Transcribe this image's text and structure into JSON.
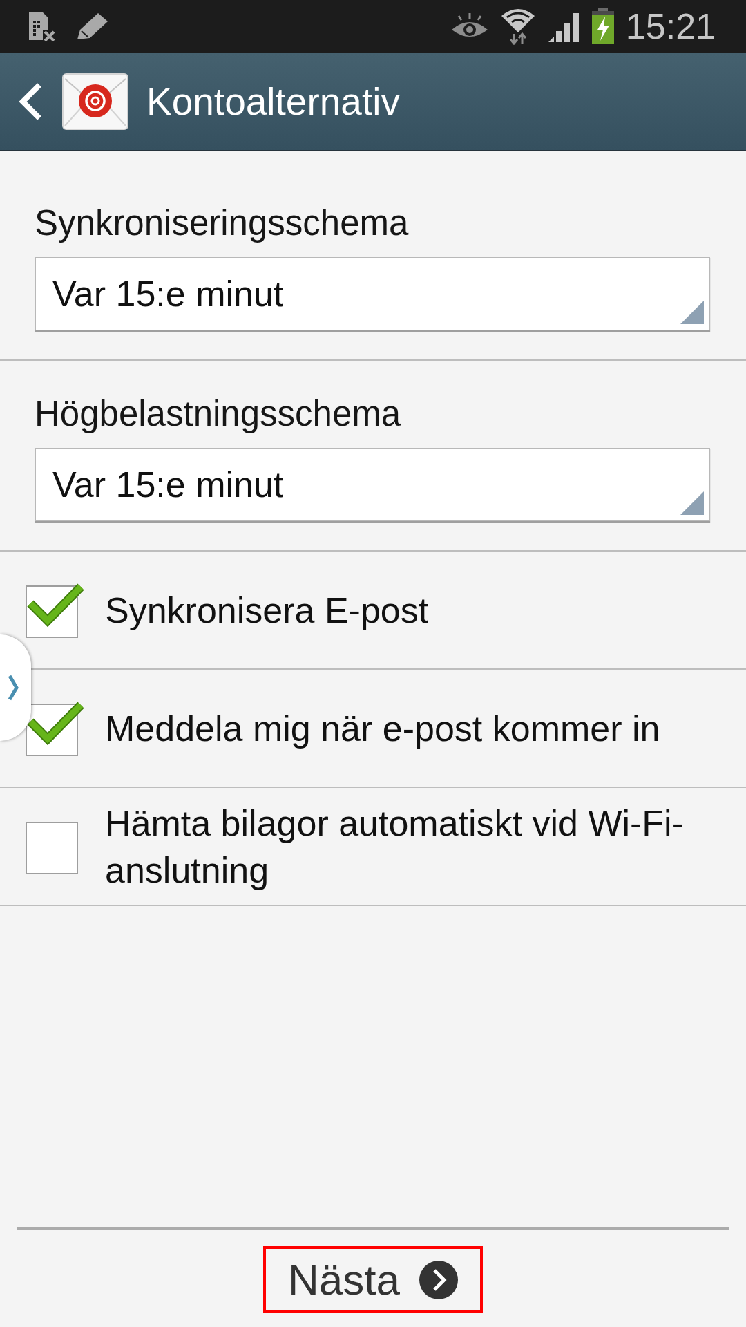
{
  "status_bar": {
    "time": "15:21"
  },
  "action_bar": {
    "title": "Kontoalternativ"
  },
  "schedules": [
    {
      "label": "Synkroniseringsschema",
      "value": "Var 15:e minut"
    },
    {
      "label": "Högbelastningsschema",
      "value": "Var 15:e minut"
    }
  ],
  "options": [
    {
      "label": "Synkronisera E-post",
      "checked": true
    },
    {
      "label": "Meddela mig när e-post kommer in",
      "checked": true
    },
    {
      "label": "Hämta bilagor automatiskt vid Wi-Fi-anslutning",
      "checked": false
    }
  ],
  "next_button": {
    "label": "Nästa",
    "highlighted": true
  }
}
